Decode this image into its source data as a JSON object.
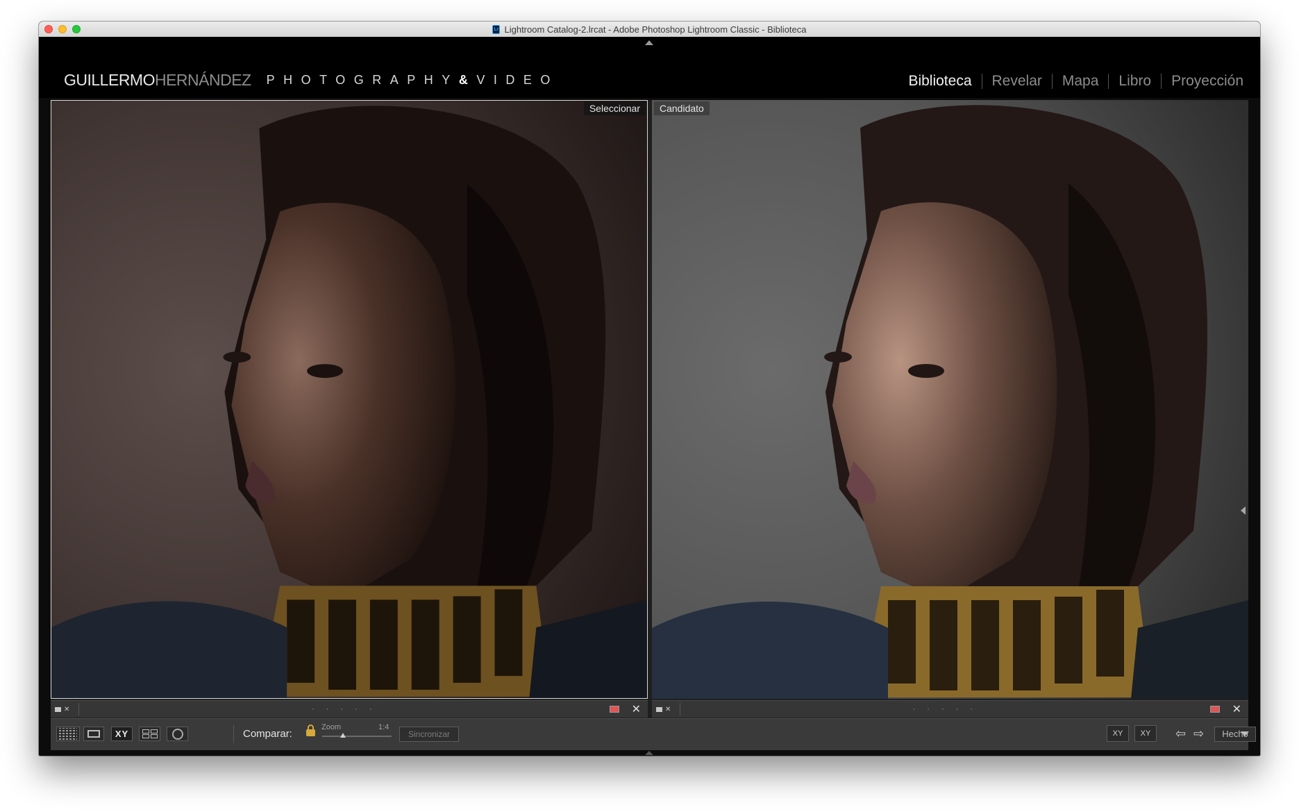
{
  "window": {
    "title": "Lightroom Catalog-2.lrcat - Adobe Photoshop Lightroom Classic - Biblioteca",
    "app_icon": "Lr"
  },
  "identity_plate": {
    "name_first": "GUILLERMO",
    "name_last": "HERNÁNDEZ",
    "tagline_a": "PHOTOGRAPHY",
    "tagline_amp": "&",
    "tagline_b": "VIDEO"
  },
  "modules": [
    {
      "label": "Biblioteca",
      "active": true
    },
    {
      "label": "Revelar",
      "active": false
    },
    {
      "label": "Mapa",
      "active": false
    },
    {
      "label": "Libro",
      "active": false
    },
    {
      "label": "Proyección",
      "active": false
    }
  ],
  "compare": {
    "select_label": "Seleccionar",
    "candidate_label": "Candidato",
    "left_stars": "· · · · ·",
    "right_stars": "· · · · ·",
    "left_color_label": "#e05555",
    "right_color_label": "#e05555"
  },
  "toolbar": {
    "compare_label": "Comparar:",
    "zoom_label": "Zoom",
    "zoom_value": "1:4",
    "zoom_level_fraction": 0.3,
    "sync_label": "Sincronizar",
    "swap_label": "XY",
    "make_select_label": "XY",
    "done_label": "Hecho",
    "xy_label": "XY"
  },
  "icons": {
    "grid": "grid-view-icon",
    "loupe": "loupe-view-icon",
    "compare": "compare-view-icon",
    "survey": "survey-view-icon",
    "people": "people-view-icon",
    "lock": "lock-icon",
    "prev": "left-arrow-icon",
    "next": "right-arrow-icon"
  }
}
